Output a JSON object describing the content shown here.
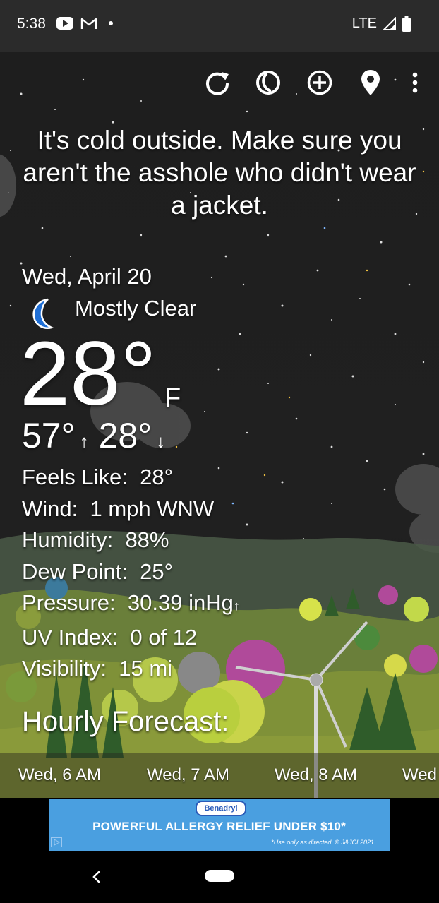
{
  "status_bar": {
    "time": "5:38",
    "network": "LTE",
    "icons": [
      "youtube-icon",
      "gmail-icon",
      "dot-icon",
      "signal-icon",
      "battery-icon"
    ]
  },
  "toolbar": {
    "icons": [
      "refresh-icon",
      "moon-phase-icon",
      "add-location-icon",
      "location-pin-icon",
      "more-vert-icon"
    ]
  },
  "headline": "It's cold outside. Make sure you aren't the asshole who didn't wear a jacket.",
  "current": {
    "date": "Wed, April 20",
    "condition": "Mostly Clear",
    "condition_icon": "crescent-moon-icon",
    "temperature": "28°",
    "unit": "F",
    "high": "57°",
    "low": "28°"
  },
  "details": {
    "feels_like_label": "Feels Like:",
    "feels_like": "28°",
    "wind_label": "Wind:",
    "wind": "1 mph WNW",
    "humidity_label": "Humidity:",
    "humidity": "88%",
    "dew_point_label": "Dew Point:",
    "dew_point": "25°",
    "pressure_label": "Pressure:",
    "pressure": "30.39 inHg",
    "uv_label": "UV Index:",
    "uv": "0 of 12",
    "visibility_label": "Visibility:",
    "visibility": "15 mi"
  },
  "hourly": {
    "title": "Hourly Forecast:",
    "hours": [
      {
        "label": "Wed, 6 AM"
      },
      {
        "label": "Wed, 7 AM"
      },
      {
        "label": "Wed, 8 AM"
      },
      {
        "label": "Wed"
      }
    ]
  },
  "ad": {
    "brand": "Benadryl",
    "headline": "POWERFUL ALLERGY RELIEF UNDER $10*",
    "disclaimer": "*Use only as directed. © J&JCI 2021"
  },
  "colors": {
    "sky": "#1e1e1e",
    "status_bar": "#2b2b2b",
    "moon": "#1f6fd6",
    "ad_background": "#4a9fe0"
  }
}
